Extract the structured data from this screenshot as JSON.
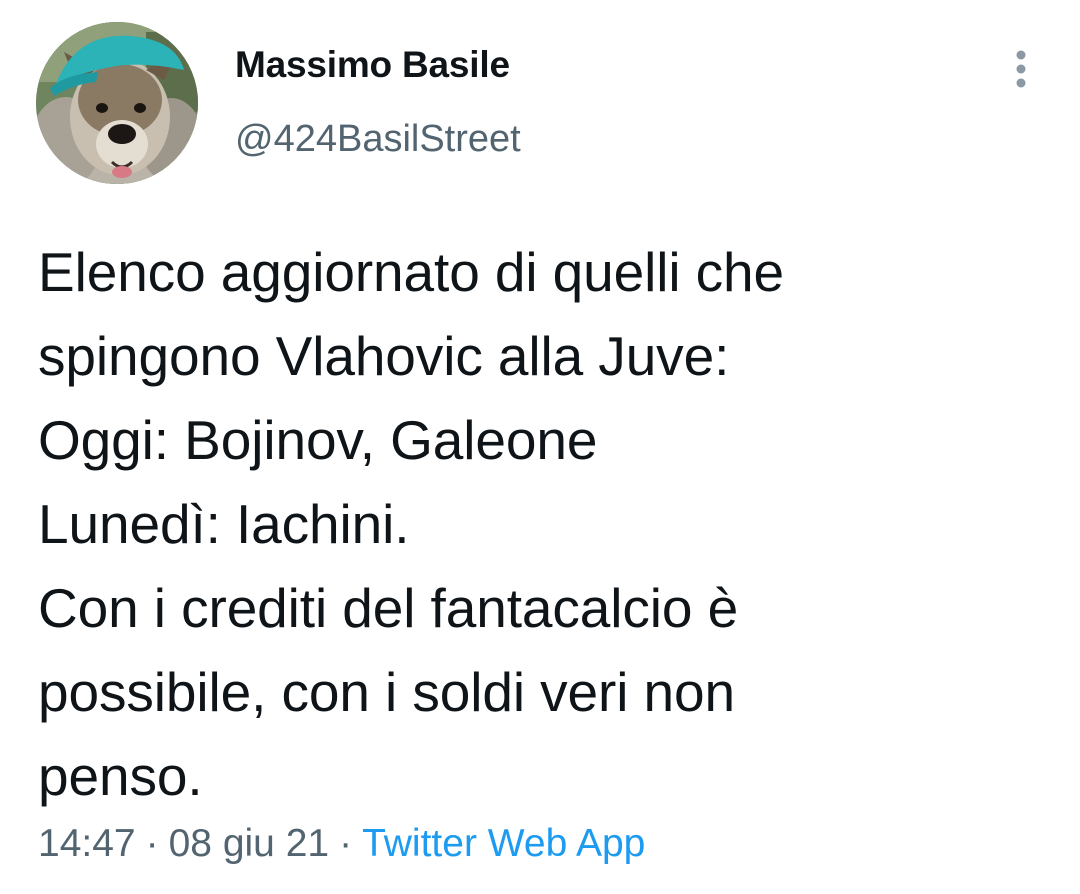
{
  "tweet": {
    "author": {
      "name": "Massimo Basile",
      "handle": "@424BasilStreet"
    },
    "text": "Elenco aggiornato di quelli che\nspingono Vlahovic alla Juve:\nOggi: Bojinov, Galeone\nLunedì: Iachini.\nCon i crediti del fantacalcio è\npossibile, con i soldi veri non\npenso.",
    "meta": {
      "time": "14:47",
      "date": "08 giu 21",
      "separator": "·",
      "source": "Twitter Web App"
    }
  },
  "icons": {
    "avatar": "dog-with-teal-cap",
    "more": "more-vertical-icon"
  },
  "colors": {
    "text": "#0f1419",
    "secondary": "#536471",
    "link": "#1d9bf0",
    "background": "#ffffff"
  }
}
